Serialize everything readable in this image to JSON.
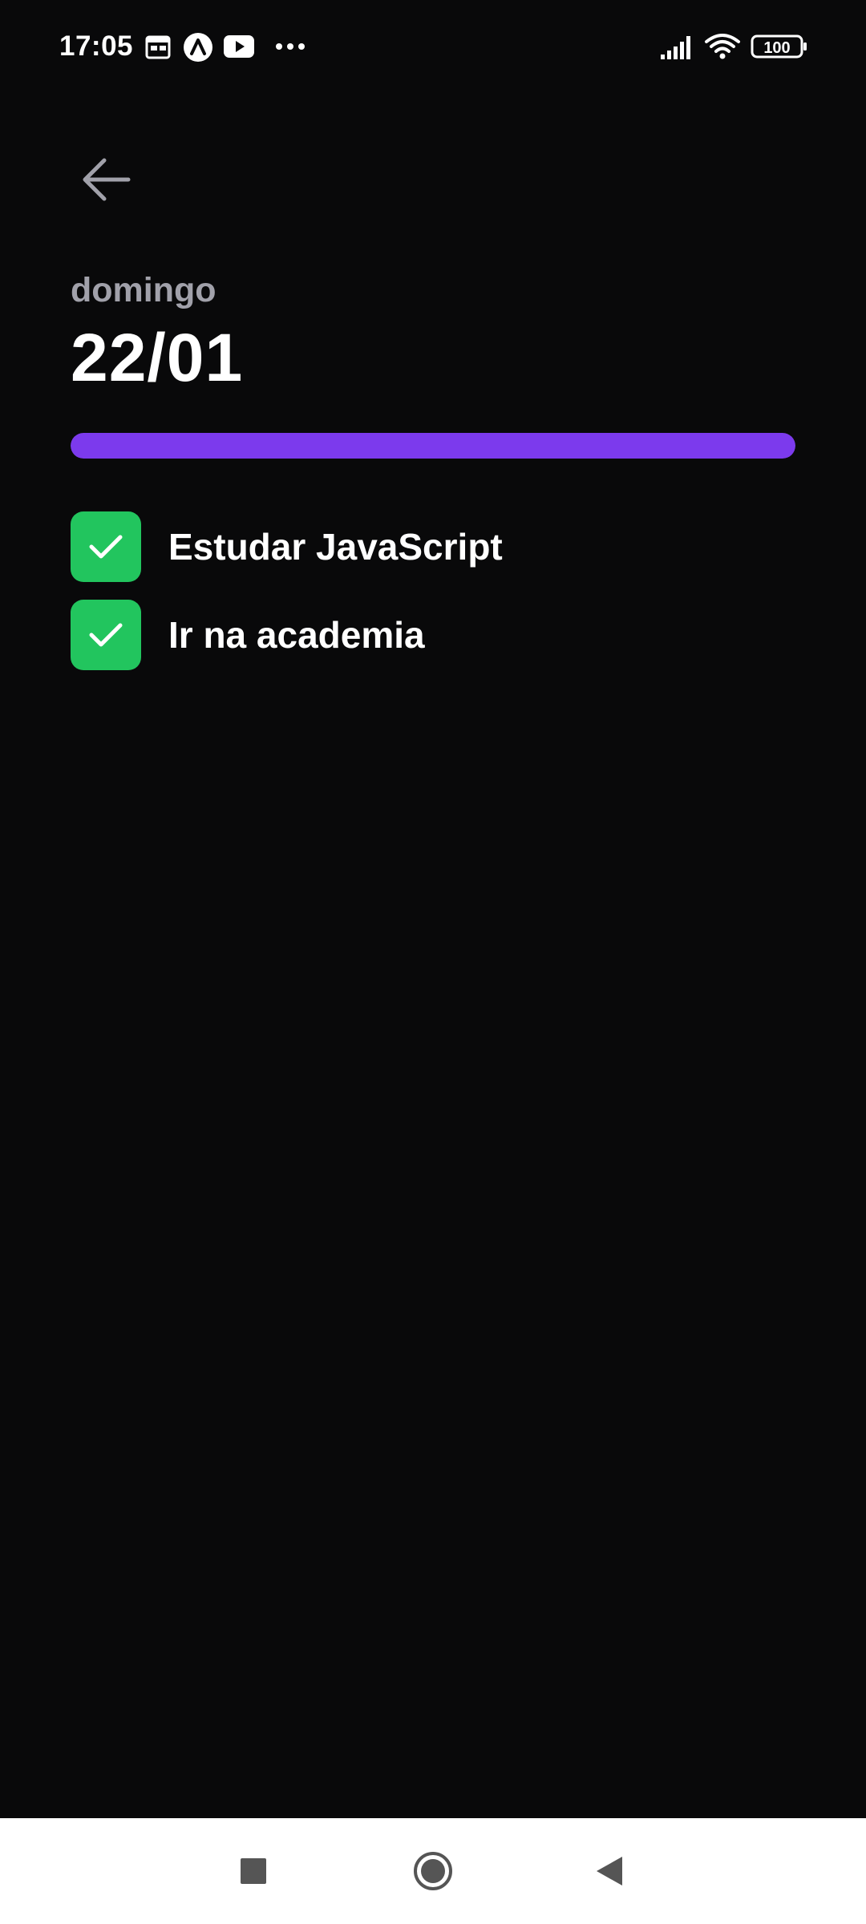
{
  "status_bar": {
    "time": "17:05",
    "notification_icons": [
      "calendar-icon",
      "app-a-icon",
      "youtube-icon",
      "more-dots-icon"
    ],
    "system_icons": [
      "signal-icon",
      "wifi-icon",
      "battery-icon"
    ],
    "battery_level": "100"
  },
  "header": {
    "weekday": "domingo",
    "date": "22/01"
  },
  "progress": {
    "percent": 100,
    "color": "#7c3aed"
  },
  "habits": [
    {
      "label": "Estudar JavaScript",
      "checked": true
    },
    {
      "label": "Ir na academia",
      "checked": true
    }
  ],
  "colors": {
    "background": "#09090a",
    "checkbox_checked": "#22c55e",
    "weekday_text": "#a1a1aa"
  },
  "nav_bar": {
    "buttons": [
      "recents-icon",
      "home-icon",
      "back-icon"
    ]
  }
}
